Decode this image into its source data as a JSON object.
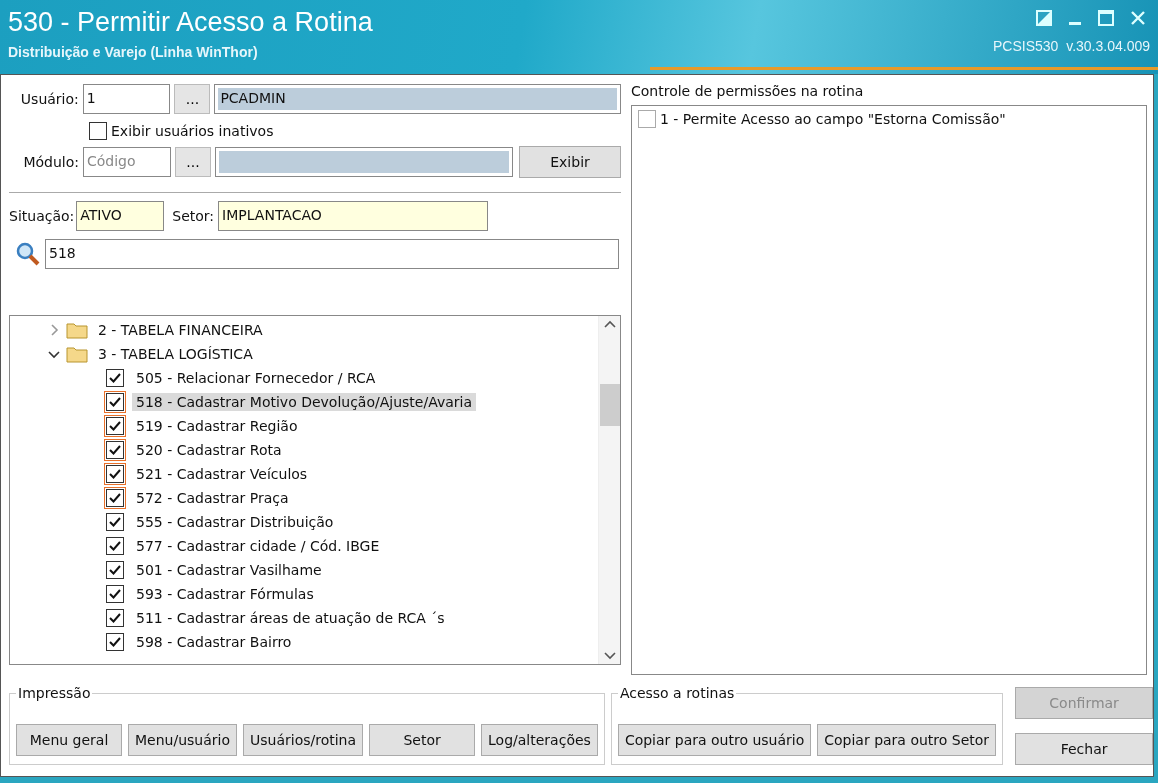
{
  "window": {
    "title": "530 - Permitir Acesso a Rotina",
    "subtitle": "Distribuição e Varejo (Linha WinThor)",
    "version": "PCSIS530  v.30.3.04.009"
  },
  "user": {
    "label": "Usuário:",
    "code": "1",
    "lookup": "...",
    "name": "PCADMIN"
  },
  "show_inactive": {
    "label": "Exibir usuários inativos",
    "checked": false
  },
  "module": {
    "label": "Módulo:",
    "placeholder": "Código",
    "lookup": "...",
    "button": "Exibir"
  },
  "status": {
    "label": "Situação:",
    "value": "ATIVO"
  },
  "sector": {
    "label": "Setor:",
    "value": "IMPLANTACAO"
  },
  "search": {
    "value": "518"
  },
  "tree": [
    {
      "label": "2 - TABELA FINANCEIRA",
      "expanded": false
    },
    {
      "label": "3 - TABELA LOGÍSTICA",
      "expanded": true,
      "children": [
        {
          "label": "505 - Relacionar Fornecedor / RCA",
          "checked": true,
          "modified": false,
          "selected": false
        },
        {
          "label": "518 - Cadastrar Motivo Devolução/Ajuste/Avaria",
          "checked": true,
          "modified": true,
          "selected": true
        },
        {
          "label": "519 - Cadastrar Região",
          "checked": true,
          "modified": true,
          "selected": false
        },
        {
          "label": "520 - Cadastrar Rota",
          "checked": true,
          "modified": true,
          "selected": false
        },
        {
          "label": "521 - Cadastrar Veículos",
          "checked": true,
          "modified": true,
          "selected": false
        },
        {
          "label": "572 - Cadastrar Praça",
          "checked": true,
          "modified": true,
          "selected": false
        },
        {
          "label": "555 - Cadastrar Distribuição",
          "checked": true,
          "modified": false,
          "selected": false
        },
        {
          "label": "577 - Cadastrar cidade / Cód. IBGE",
          "checked": true,
          "modified": false,
          "selected": false
        },
        {
          "label": "501 - Cadastrar Vasilhame",
          "checked": true,
          "modified": false,
          "selected": false
        },
        {
          "label": "593 - Cadastrar Fórmulas",
          "checked": true,
          "modified": false,
          "selected": false
        },
        {
          "label": "511 - Cadastrar áreas de atuação de RCA ´s",
          "checked": true,
          "modified": false,
          "selected": false
        },
        {
          "label": "598 - Cadastrar Bairro",
          "checked": true,
          "modified": false,
          "selected": false
        }
      ]
    }
  ],
  "permissions": {
    "title": "Controle de permissões na rotina",
    "items": [
      {
        "label": "1 - Permite Acesso ao campo \"Estorna Comissão\"",
        "checked": false
      }
    ]
  },
  "print_group": {
    "title": "Impressão",
    "buttons": [
      "Menu geral",
      "Menu/usuário",
      "Usuários/rotina",
      "Setor",
      "Log/alterações"
    ]
  },
  "access_group": {
    "title": "Acesso a rotinas",
    "buttons": [
      "Copiar para outro usuário",
      "Copiar para outro Setor"
    ]
  },
  "actions": [
    {
      "label": "Confirmar",
      "disabled": true
    },
    {
      "label": "Fechar",
      "disabled": false
    }
  ]
}
